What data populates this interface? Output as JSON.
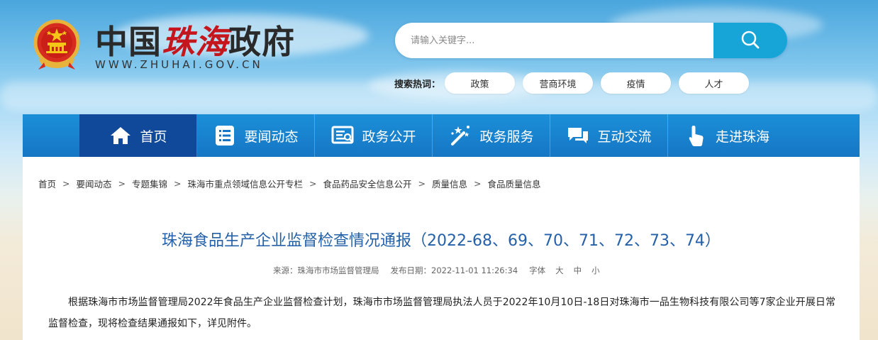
{
  "header": {
    "title_part1": "中国",
    "title_part2": "珠海",
    "title_part3": "政府",
    "url": "WWW.ZHUHAI.GOV.CN"
  },
  "search": {
    "placeholder": "请输入关键字...",
    "button_icon": "search-icon"
  },
  "hot_search": {
    "label": "搜索热词：",
    "tags": [
      "政策",
      "营商环境",
      "疫情",
      "人才"
    ]
  },
  "nav": {
    "items": [
      {
        "label": "首页",
        "icon": "home-icon"
      },
      {
        "label": "要闻动态",
        "icon": "list-icon"
      },
      {
        "label": "政务公开",
        "icon": "document-icon"
      },
      {
        "label": "政务服务",
        "icon": "magic-wand-icon"
      },
      {
        "label": "互动交流",
        "icon": "chat-icon"
      },
      {
        "label": "走进珠海",
        "icon": "hand-pointer-icon"
      }
    ],
    "active_index": 0
  },
  "breadcrumb": [
    "首页",
    "要闻动态",
    "专题集锦",
    "珠海市重点领域信息公开专栏",
    "食品药品安全信息公开",
    "质量信息",
    "食品质量信息"
  ],
  "article": {
    "title": "珠海食品生产企业监督检查情况通报（2022-68、69、70、71、72、73、74）",
    "source": "来源：珠海市市场监督管理局",
    "date": "发布日期：2022-11-01 11:26:34",
    "font_label": "字体",
    "font_large": "大",
    "font_medium": "中",
    "font_small": "小",
    "body": "根据珠海市市场监督管理局2022年食品生产企业监督检查计划，珠海市市场监督管理局执法人员于2022年10月10日-18日对珠海市一品生物科技有限公司等7家企业开展日常监督检查，现将检查结果通报如下，详见附件。"
  },
  "colors": {
    "nav_blue": "#1676c4",
    "nav_active": "#10489a",
    "search_button": "#17a5d8",
    "title_red": "#c4161c",
    "article_title": "#2461a8"
  }
}
